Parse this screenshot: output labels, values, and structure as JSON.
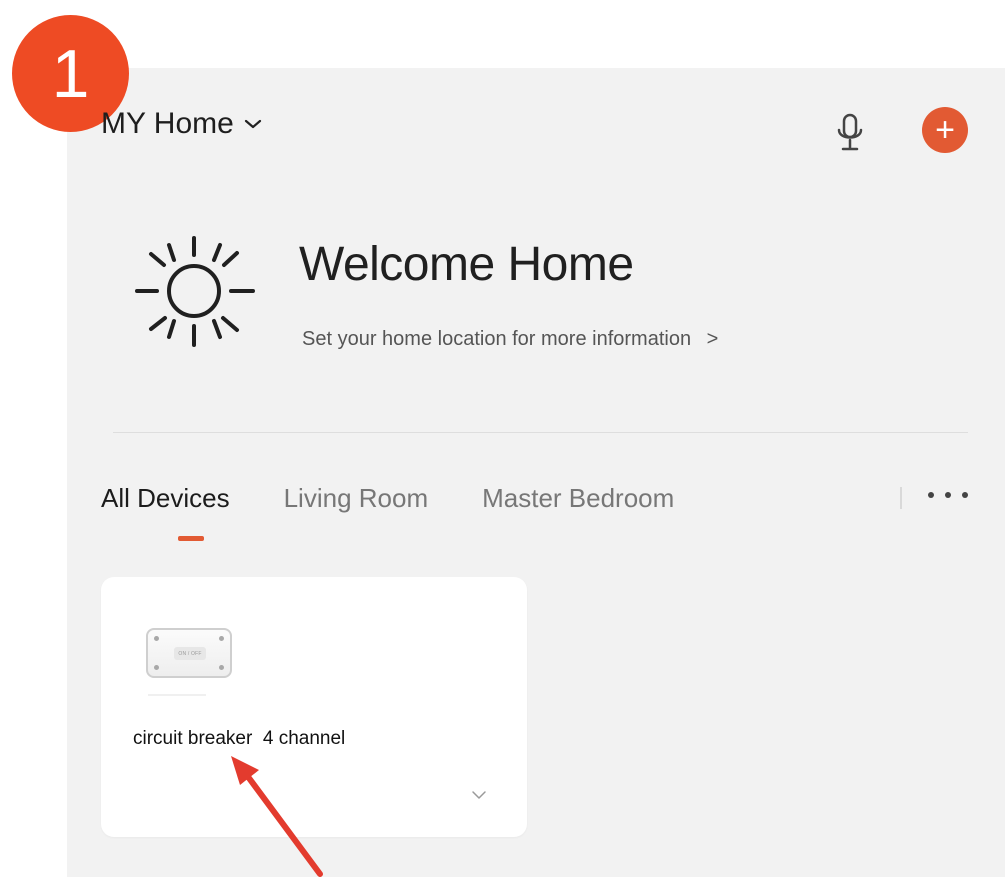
{
  "step": {
    "number": "1",
    "color": "#ee4b24"
  },
  "header": {
    "home_name": "MY Home",
    "dropdown_icon": "chevron-down-icon",
    "mic_icon": "microphone-icon",
    "add_icon": "plus-icon",
    "add_symbol": "+"
  },
  "welcome": {
    "title": "Welcome Home",
    "subtitle": "Set your home location for more information",
    "link_arrow": ">",
    "icon": "sun-icon"
  },
  "tabs": [
    {
      "label": "All Devices",
      "active": true
    },
    {
      "label": "Living Room",
      "active": false
    },
    {
      "label": "Master Bedroom",
      "active": false
    }
  ],
  "more_icon": "more-horizontal-icon",
  "devices": [
    {
      "name": "circuit breaker  4 channel",
      "image_label": "ON / OFF",
      "expand_icon": "chevron-down-icon"
    }
  ],
  "colors": {
    "accent": "#e25a33",
    "panel_background": "#f2f2f2",
    "card_background": "#ffffff",
    "arrow": "#e33b2e"
  }
}
